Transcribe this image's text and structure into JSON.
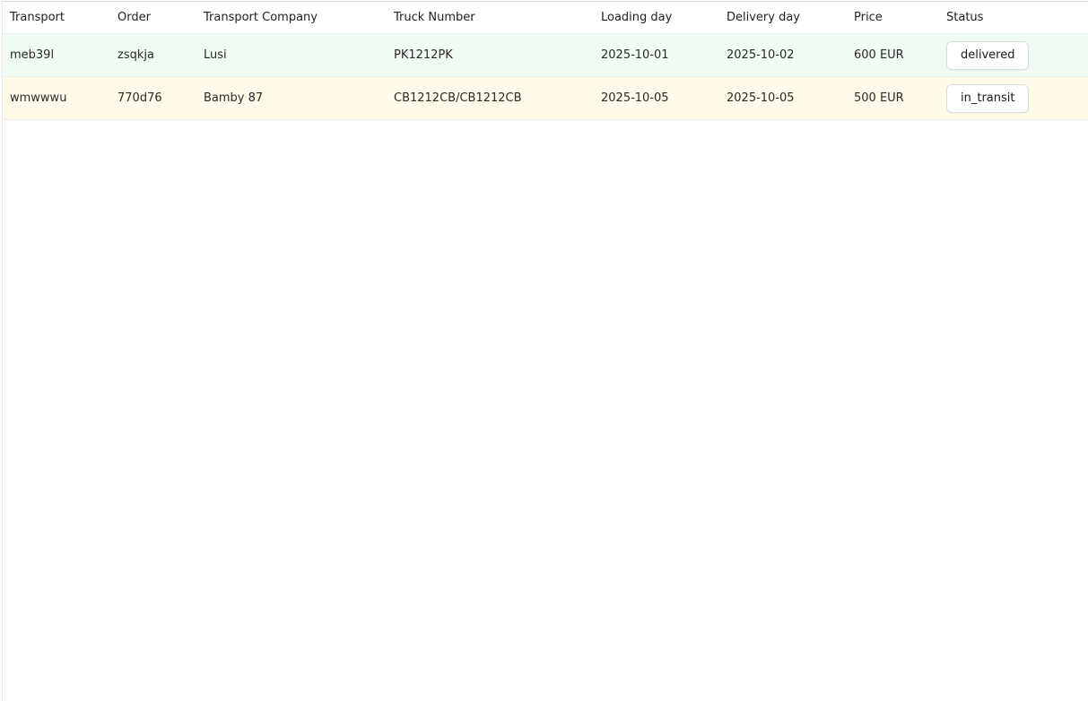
{
  "table": {
    "columns": [
      "Transport",
      "Order",
      "Transport Company",
      "Truck Number",
      "Loading day",
      "Delivery day",
      "Price",
      "Status"
    ],
    "rows": [
      {
        "transport": "meb39l",
        "order": "zsqkja",
        "company": "Lusi",
        "truck": "PK1212PK",
        "loading_day": "2025-10-01",
        "delivery_day": "2025-10-02",
        "price": "600 EUR",
        "status": "delivered",
        "row_color": "#effbf3"
      },
      {
        "transport": "wmwwwu",
        "order": "770d76",
        "company": "Bamby 87",
        "truck": "CB1212CB/CB1212CB",
        "loading_day": "2025-10-05",
        "delivery_day": "2025-10-05",
        "price": "500 EUR",
        "status": "in_transit",
        "row_color": "#fffbe8"
      }
    ]
  }
}
